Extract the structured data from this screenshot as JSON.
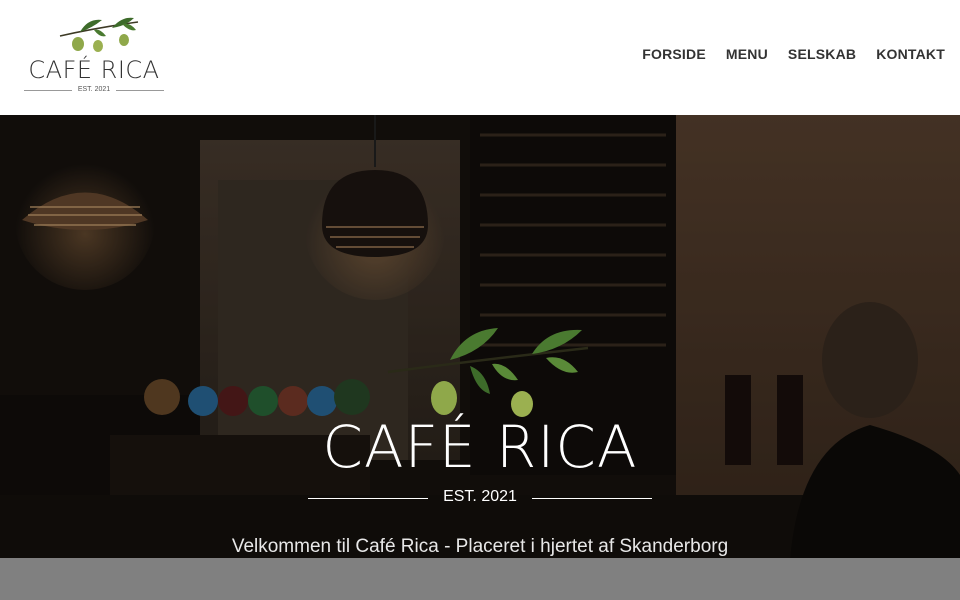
{
  "brand": {
    "name": "CAFÉ RICA",
    "established": "EST. 2021"
  },
  "nav": {
    "items": [
      {
        "label": "FORSIDE"
      },
      {
        "label": "MENU"
      },
      {
        "label": "SELSKAB"
      },
      {
        "label": "KONTAKT"
      }
    ]
  },
  "hero": {
    "title": "CAFÉ RICA",
    "established": "EST. 2021",
    "tagline": "Velkommen til Café Rica - Placeret i hjertet af Skanderborg"
  },
  "colors": {
    "olive_green": "#8fa84a",
    "leaf_green": "#3d6b2a",
    "text_dark": "#333333",
    "bottom_bar": "#808080"
  },
  "icons": {
    "logo_branch": "olive-branch-icon"
  }
}
